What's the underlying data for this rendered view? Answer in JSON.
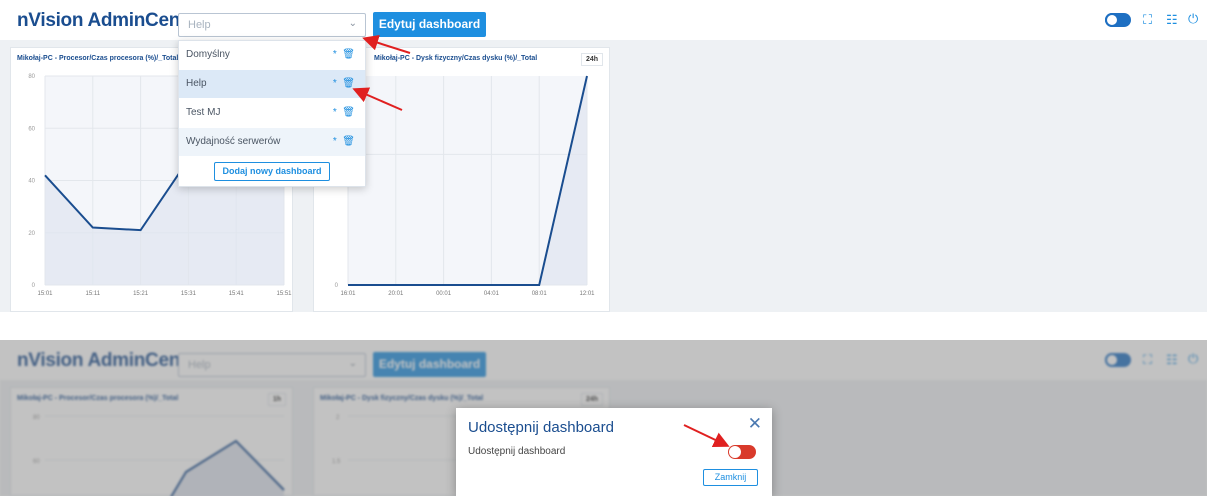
{
  "app": {
    "title": "nVision AdminCenter"
  },
  "toolbar": {
    "dashboard_select_value": "Help",
    "edit_button": "Edytuj dashboard",
    "icons": [
      "network-toggle-icon",
      "fullscreen-icon",
      "grid-icon",
      "power-icon"
    ]
  },
  "dropdown": {
    "items": [
      {
        "label": "Domyślny"
      },
      {
        "label": "Help"
      },
      {
        "label": "Test MJ"
      },
      {
        "label": "Wydajność serwerów"
      }
    ],
    "add_button": "Dodaj nowy dashboard"
  },
  "panels": [
    {
      "title": "Mikołaj-PC - Procesor/Czas procesora (%)/_Total",
      "badge": "1h",
      "chart_data": {
        "type": "area",
        "x": [
          "15:01",
          "15:11",
          "15:21",
          "15:31",
          "15:41",
          "15:51"
        ],
        "y": [
          42,
          22,
          21,
          48,
          72,
          44
        ],
        "ylim": [
          0,
          80
        ],
        "yticks": [
          "0",
          "20",
          "40",
          "60",
          "80"
        ],
        "grid": true
      }
    },
    {
      "title": "Mikołaj-PC - Dysk fizyczny/Czas dysku (%)/_Total",
      "badge": "24h",
      "chart_data": {
        "type": "area",
        "x": [
          "16:01",
          "20:01",
          "00:01",
          "04:01",
          "08:01",
          "12:01"
        ],
        "y": [
          0,
          0,
          0,
          0,
          0,
          0.8
        ],
        "ylim": [
          0,
          0.8
        ],
        "yticks": [
          "0",
          "0.5"
        ],
        "grid": true
      }
    }
  ],
  "bottom": {
    "app_title": "nVision AdminCenter",
    "select_value": "Help",
    "edit_button": "Edytuj dashboard",
    "panel1_title": "Mikołaj-PC - Procesor/Czas procesora (%)/_Total",
    "panel1_badge": "1h",
    "panel2_title": "Mikołaj-PC - Dysk fizyczny/Czas dysku (%)/_Total",
    "panel2_badge": "24h",
    "yticks1": [
      "80",
      "60"
    ],
    "yticks2": [
      "2",
      "1.5"
    ]
  },
  "modal": {
    "title": "Udostępnij dashboard",
    "label": "Udostępnij dashboard",
    "toggle_on": false,
    "close_button": "Zamknij"
  },
  "colors": {
    "brand": "#1a4d8f",
    "accent": "#1e8fe0",
    "toggle_red": "#d93a2b",
    "annotation_arrow": "#e02020"
  }
}
